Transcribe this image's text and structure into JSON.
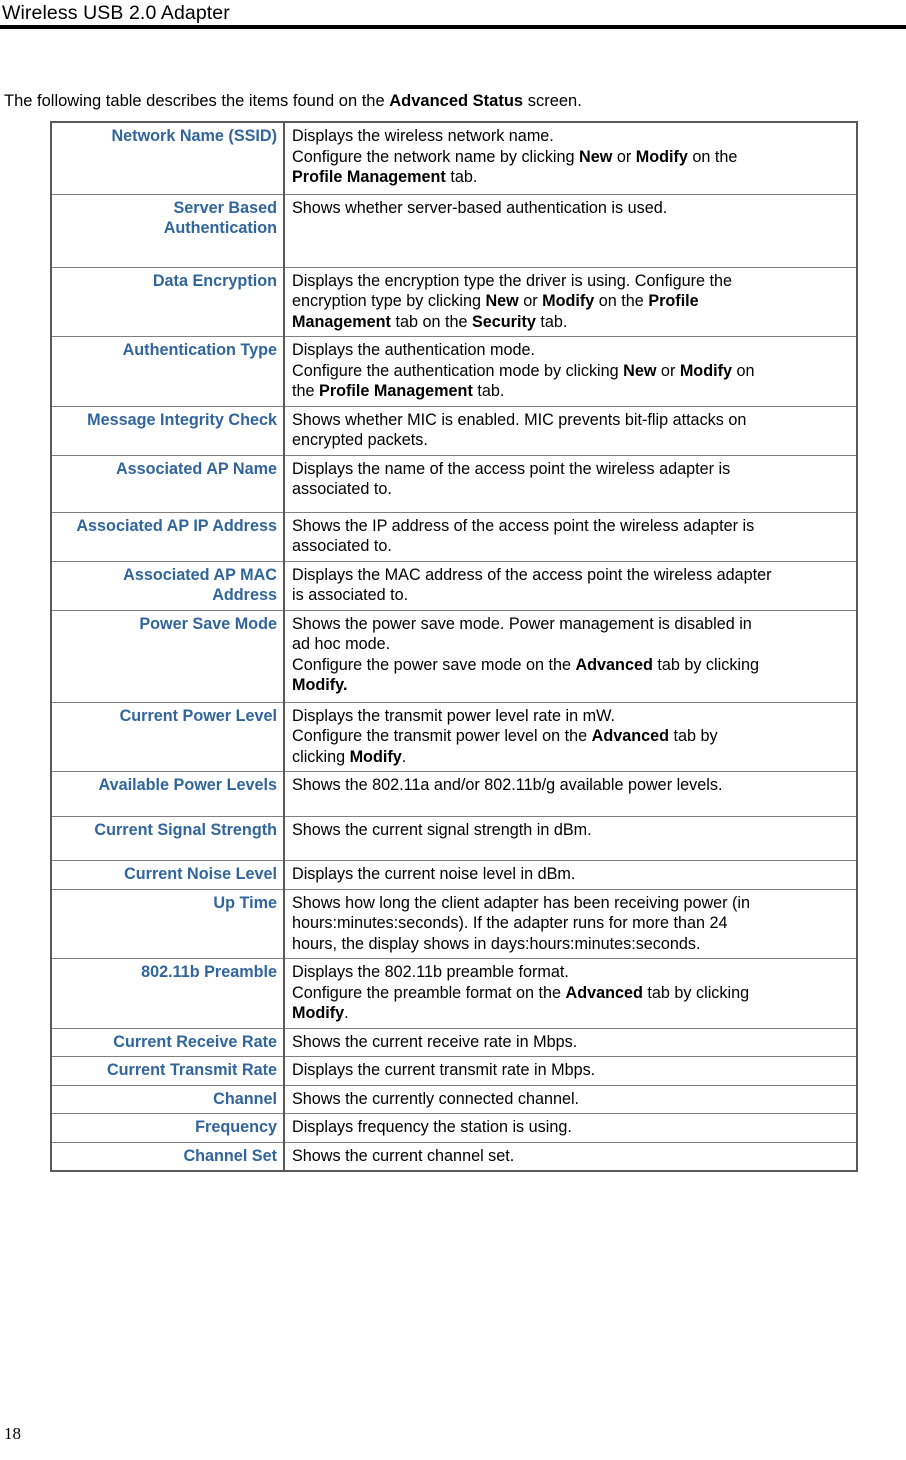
{
  "header": {
    "title": "Wireless USB 2.0 Adapter"
  },
  "intro": {
    "before": "The following table describes the items found on the ",
    "emphasis": "Advanced Status",
    "after": " screen."
  },
  "footer": {
    "page_number": "18"
  },
  "colors": {
    "label_blue": "#31659C",
    "table_border": "#595959",
    "cell_border": "#7f7f7f",
    "text": "#000000"
  },
  "table": {
    "rows": [
      {
        "label": "Network Name (SSID)",
        "lines": [
          [
            {
              "t": "Displays the wireless network name.",
              "b": false
            }
          ],
          [
            {
              "t": "Configure the network name by clicking ",
              "b": false
            },
            {
              "t": "New",
              "b": true
            },
            {
              "t": " or ",
              "b": false
            },
            {
              "t": "Modify",
              "b": true
            },
            {
              "t": " on the ",
              "b": false
            }
          ],
          [
            {
              "t": "Profile Management",
              "b": true
            },
            {
              "t": " tab.",
              "b": false
            }
          ]
        ]
      },
      {
        "label": "Server Based Authentication",
        "lines": [
          [
            {
              "t": "Shows whether server-based authentication is used.",
              "b": false
            }
          ]
        ]
      },
      {
        "label": "Data Encryption",
        "lines": [
          [
            {
              "t": "Displays the encryption type the driver is using. Configure the",
              "b": false
            }
          ],
          [
            {
              "t": "encryption type by clicking ",
              "b": false
            },
            {
              "t": "New",
              "b": true
            },
            {
              "t": " or ",
              "b": false
            },
            {
              "t": "Modify",
              "b": true
            },
            {
              "t": " on the ",
              "b": false
            },
            {
              "t": "Profile",
              "b": true
            }
          ],
          [
            {
              "t": "Management",
              "b": true
            },
            {
              "t": " tab on the ",
              "b": false
            },
            {
              "t": "Security",
              "b": true
            },
            {
              "t": " tab.",
              "b": false
            }
          ]
        ]
      },
      {
        "label": "Authentication Type",
        "lines": [
          [
            {
              "t": "Displays the authentication mode.",
              "b": false
            }
          ],
          [
            {
              "t": "Configure the authentication mode by clicking ",
              "b": false
            },
            {
              "t": "New",
              "b": true
            },
            {
              "t": " or ",
              "b": false
            },
            {
              "t": "Modify",
              "b": true
            },
            {
              "t": " on",
              "b": false
            }
          ],
          [
            {
              "t": "the ",
              "b": false
            },
            {
              "t": "Profile Management",
              "b": true
            },
            {
              "t": " tab.",
              "b": false
            }
          ]
        ]
      },
      {
        "label": "Message Integrity Check",
        "lines": [
          [
            {
              "t": "Shows whether MIC is enabled. MIC prevents bit-flip attacks on",
              "b": false
            }
          ],
          [
            {
              "t": "encrypted packets.",
              "b": false
            }
          ]
        ]
      },
      {
        "label": "Associated AP Name",
        "lines": [
          [
            {
              "t": "Displays the name of the access point the wireless adapter is",
              "b": false
            }
          ],
          [
            {
              "t": "associated to.",
              "b": false
            }
          ]
        ]
      },
      {
        "label": "Associated AP IP Address",
        "lines": [
          [
            {
              "t": "Shows the IP address of the access point the wireless adapter is",
              "b": false
            }
          ],
          [
            {
              "t": "associated to.",
              "b": false
            }
          ]
        ]
      },
      {
        "label": "Associated AP MAC Address",
        "lines": [
          [
            {
              "t": "Displays the MAC address of the access point the wireless adapter",
              "b": false
            }
          ],
          [
            {
              "t": "is associated to.",
              "b": false
            }
          ]
        ]
      },
      {
        "label": "Power Save Mode",
        "lines": [
          [
            {
              "t": "Shows the power save mode. Power management is disabled in",
              "b": false
            }
          ],
          [
            {
              "t": "ad hoc mode.",
              "b": false
            }
          ],
          [
            {
              "t": "Configure the power save mode on the ",
              "b": false
            },
            {
              "t": "Advanced",
              "b": true
            },
            {
              "t": " tab by clicking",
              "b": false
            }
          ],
          [
            {
              "t": "Modify.",
              "b": true
            }
          ]
        ]
      },
      {
        "label": "Current Power Level",
        "lines": [
          [
            {
              "t": "Displays the transmit power level rate in mW.",
              "b": false
            }
          ],
          [
            {
              "t": "Configure the transmit power level on the ",
              "b": false
            },
            {
              "t": "Advanced",
              "b": true
            },
            {
              "t": " tab by",
              "b": false
            }
          ],
          [
            {
              "t": "clicking ",
              "b": false
            },
            {
              "t": "Modify",
              "b": true
            },
            {
              "t": ".",
              "b": false
            }
          ]
        ]
      },
      {
        "label": "Available Power Levels",
        "lines": [
          [
            {
              "t": "Shows the 802.11a and/or 802.11b/g available power levels.",
              "b": false
            }
          ]
        ]
      },
      {
        "label": "Current Signal Strength",
        "lines": [
          [
            {
              "t": "Shows the current signal strength in dBm.",
              "b": false
            }
          ]
        ]
      },
      {
        "label": "Current Noise Level",
        "lines": [
          [
            {
              "t": "Displays the current noise level in dBm.",
              "b": false
            }
          ]
        ]
      },
      {
        "label": "Up Time",
        "lines": [
          [
            {
              "t": "Shows how long the client adapter has been receiving power (in",
              "b": false
            }
          ],
          [
            {
              "t": "hours:minutes:seconds). If the adapter runs for more than 24",
              "b": false
            }
          ],
          [
            {
              "t": "hours, the display shows in days:hours:minutes:seconds.",
              "b": false
            }
          ]
        ]
      },
      {
        "label": "802.11b Preamble",
        "lines": [
          [
            {
              "t": "Displays the 802.11b preamble format.",
              "b": false
            }
          ],
          [
            {
              "t": "Configure the preamble format on the ",
              "b": false
            },
            {
              "t": "Advanced",
              "b": true
            },
            {
              "t": " tab by clicking",
              "b": false
            }
          ],
          [
            {
              "t": "Modify",
              "b": true
            },
            {
              "t": ".",
              "b": false
            }
          ]
        ]
      },
      {
        "label": "Current Receive Rate",
        "lines": [
          [
            {
              "t": "Shows the current receive rate in Mbps.",
              "b": false
            }
          ]
        ]
      },
      {
        "label": "Current Transmit Rate",
        "lines": [
          [
            {
              "t": "Displays the current transmit rate in Mbps.",
              "b": false
            }
          ]
        ]
      },
      {
        "label": "Channel",
        "lines": [
          [
            {
              "t": "Shows the currently connected channel.",
              "b": false
            }
          ]
        ]
      },
      {
        "label": "Frequency",
        "lines": [
          [
            {
              "t": "Displays frequency the station is using.",
              "b": false
            }
          ]
        ]
      },
      {
        "label": "Channel Set",
        "lines": [
          [
            {
              "t": "Shows the current channel set.",
              "b": false
            }
          ]
        ]
      }
    ]
  }
}
